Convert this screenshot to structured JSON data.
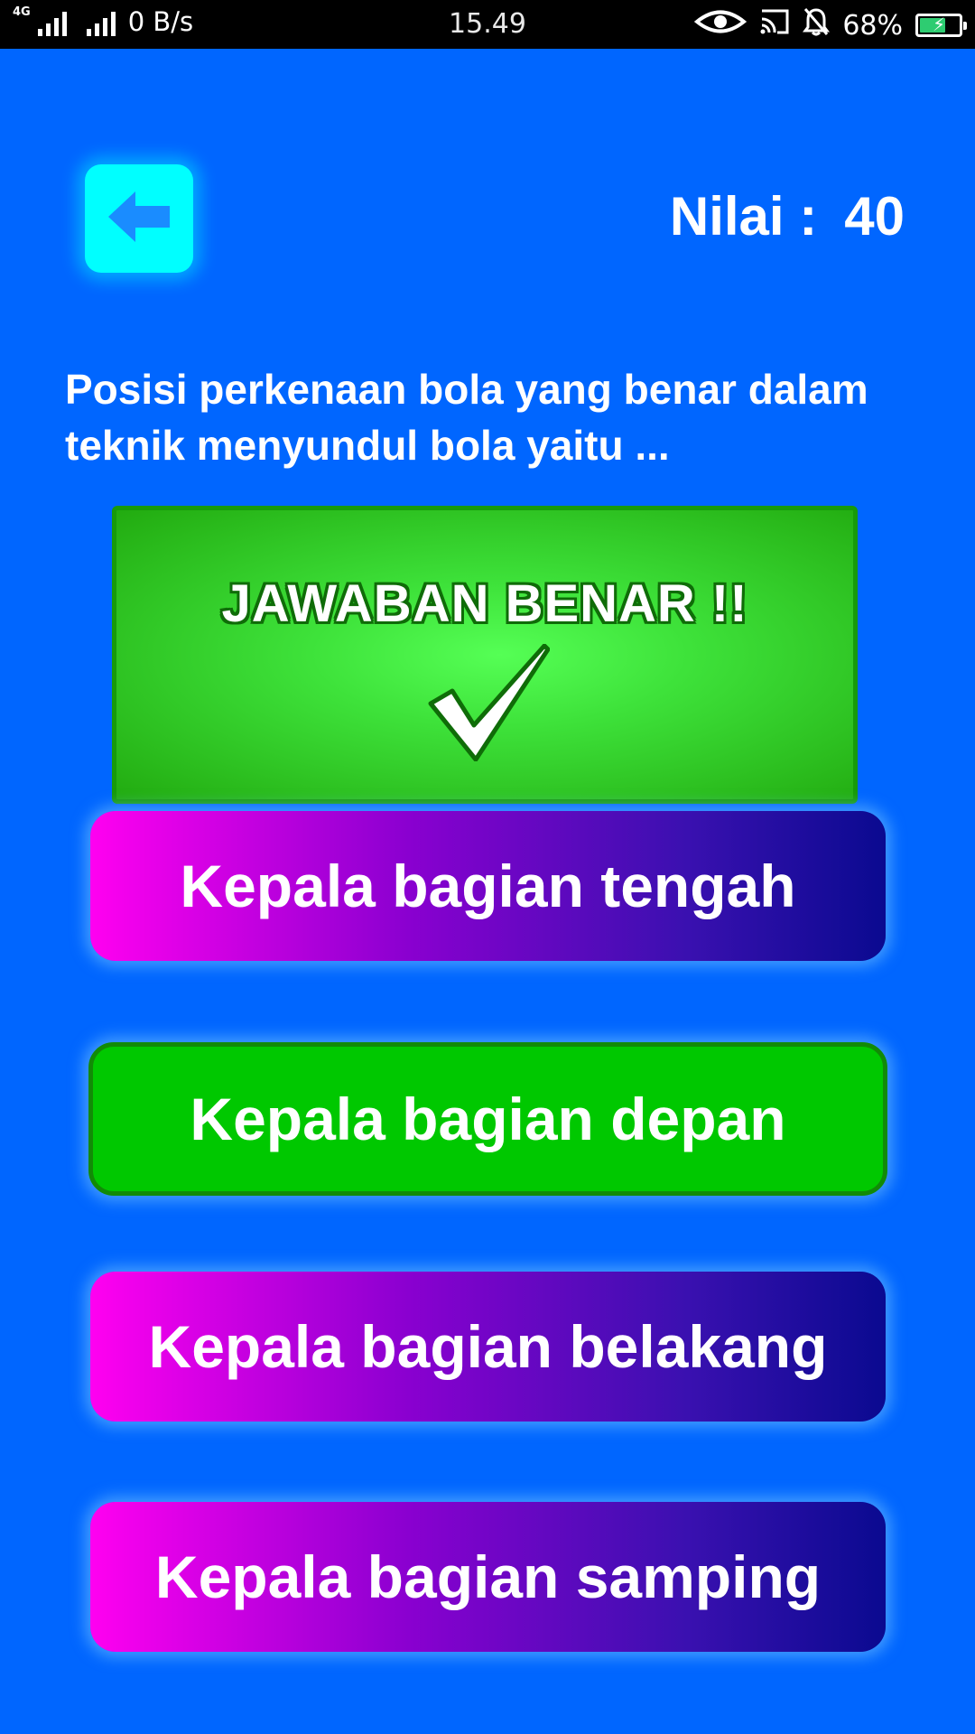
{
  "status_bar": {
    "network_type": "4G",
    "data_speed": "0 B/s",
    "time": "15.49",
    "battery_percent": "68%",
    "battery_level": 0.68,
    "icons": [
      "eye-icon",
      "cast-icon",
      "bell-off-icon",
      "battery-charging-icon"
    ]
  },
  "header": {
    "back_icon": "arrow-left-icon",
    "score_label": "Nilai :",
    "score_value": "40"
  },
  "question": {
    "text": "Posisi perkenaan bola yang benar dalam teknik menyundul bola yaitu ..."
  },
  "feedback": {
    "title": "JAWABAN BENAR !!",
    "icon": "checkmark-icon"
  },
  "answers": [
    {
      "label": "Kepala bagian tengah",
      "state": "normal"
    },
    {
      "label": "Kepala bagian depan",
      "state": "correct"
    },
    {
      "label": "Kepala bagian belakang",
      "state": "normal"
    },
    {
      "label": "Kepala bagian samping",
      "state": "normal"
    }
  ],
  "colors": {
    "background": "#0066ff",
    "back_button": "#00ffff",
    "correct": "#00c800",
    "answer_gradient_start": "#ff00f0",
    "answer_gradient_end": "#0a0a90"
  }
}
